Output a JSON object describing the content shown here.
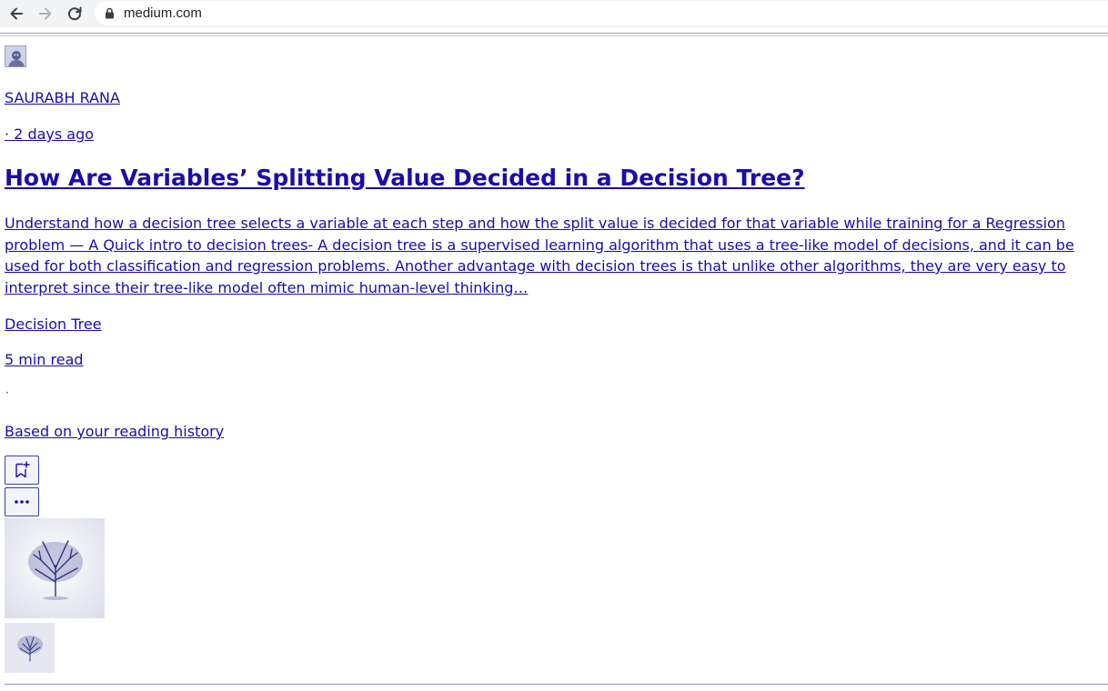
{
  "browser": {
    "back_icon": "arrow-left-icon",
    "forward_icon": "arrow-right-icon",
    "reload_icon": "reload-icon",
    "lock_icon": "lock-icon",
    "url": "medium.com"
  },
  "article": {
    "author": "SAURABH RANA",
    "date": "· 2 days ago",
    "title": "How Are Variables’ Splitting Value Decided in a Decision Tree?",
    "excerpt": "Understand how a decision tree selects a variable at each step and how the split value is decided for that variable while training for a Regression problem — A Quick intro to decision trees- A decision tree is a supervised learning algorithm that uses a tree-like model of decisions, and it can be used for both classification and regression problems. Another advantage with decision trees is that unlike other algorithms, they are very easy to interpret since their tree-like model often mimic human-level thinking…",
    "tag": "Decision Tree",
    "read_time": "5 min read",
    "separator": "·",
    "reason": "Based on your reading history",
    "bookmark_icon": "bookmark-add-icon",
    "more_icon": "more-dots-icon"
  },
  "colors": {
    "link": "#1a0dab",
    "chrome_bg": "#f1f3f4",
    "button_border": "#3b3bb6"
  }
}
